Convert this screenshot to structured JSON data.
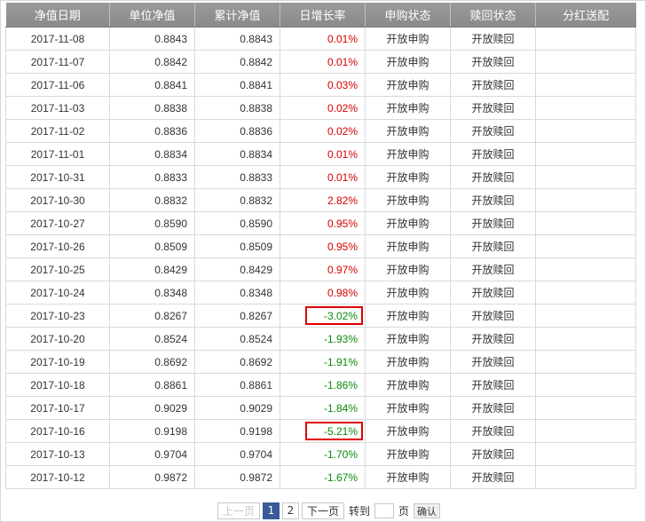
{
  "table": {
    "headers": [
      "净值日期",
      "单位净值",
      "累计净值",
      "日增长率",
      "申购状态",
      "赎回状态",
      "分红送配"
    ],
    "rows": [
      {
        "date": "2017-11-08",
        "nav": "0.8843",
        "acc": "0.8843",
        "chg": "0.01%",
        "dir": "up",
        "buy": "开放申购",
        "sell": "开放赎回",
        "div": "",
        "highlight": false
      },
      {
        "date": "2017-11-07",
        "nav": "0.8842",
        "acc": "0.8842",
        "chg": "0.01%",
        "dir": "up",
        "buy": "开放申购",
        "sell": "开放赎回",
        "div": "",
        "highlight": false
      },
      {
        "date": "2017-11-06",
        "nav": "0.8841",
        "acc": "0.8841",
        "chg": "0.03%",
        "dir": "up",
        "buy": "开放申购",
        "sell": "开放赎回",
        "div": "",
        "highlight": false
      },
      {
        "date": "2017-11-03",
        "nav": "0.8838",
        "acc": "0.8838",
        "chg": "0.02%",
        "dir": "up",
        "buy": "开放申购",
        "sell": "开放赎回",
        "div": "",
        "highlight": false
      },
      {
        "date": "2017-11-02",
        "nav": "0.8836",
        "acc": "0.8836",
        "chg": "0.02%",
        "dir": "up",
        "buy": "开放申购",
        "sell": "开放赎回",
        "div": "",
        "highlight": false
      },
      {
        "date": "2017-11-01",
        "nav": "0.8834",
        "acc": "0.8834",
        "chg": "0.01%",
        "dir": "up",
        "buy": "开放申购",
        "sell": "开放赎回",
        "div": "",
        "highlight": false
      },
      {
        "date": "2017-10-31",
        "nav": "0.8833",
        "acc": "0.8833",
        "chg": "0.01%",
        "dir": "up",
        "buy": "开放申购",
        "sell": "开放赎回",
        "div": "",
        "highlight": false
      },
      {
        "date": "2017-10-30",
        "nav": "0.8832",
        "acc": "0.8832",
        "chg": "2.82%",
        "dir": "up",
        "buy": "开放申购",
        "sell": "开放赎回",
        "div": "",
        "highlight": false
      },
      {
        "date": "2017-10-27",
        "nav": "0.8590",
        "acc": "0.8590",
        "chg": "0.95%",
        "dir": "up",
        "buy": "开放申购",
        "sell": "开放赎回",
        "div": "",
        "highlight": false
      },
      {
        "date": "2017-10-26",
        "nav": "0.8509",
        "acc": "0.8509",
        "chg": "0.95%",
        "dir": "up",
        "buy": "开放申购",
        "sell": "开放赎回",
        "div": "",
        "highlight": false
      },
      {
        "date": "2017-10-25",
        "nav": "0.8429",
        "acc": "0.8429",
        "chg": "0.97%",
        "dir": "up",
        "buy": "开放申购",
        "sell": "开放赎回",
        "div": "",
        "highlight": false
      },
      {
        "date": "2017-10-24",
        "nav": "0.8348",
        "acc": "0.8348",
        "chg": "0.98%",
        "dir": "up",
        "buy": "开放申购",
        "sell": "开放赎回",
        "div": "",
        "highlight": false
      },
      {
        "date": "2017-10-23",
        "nav": "0.8267",
        "acc": "0.8267",
        "chg": "-3.02%",
        "dir": "down",
        "buy": "开放申购",
        "sell": "开放赎回",
        "div": "",
        "highlight": true
      },
      {
        "date": "2017-10-20",
        "nav": "0.8524",
        "acc": "0.8524",
        "chg": "-1.93%",
        "dir": "down",
        "buy": "开放申购",
        "sell": "开放赎回",
        "div": "",
        "highlight": false
      },
      {
        "date": "2017-10-19",
        "nav": "0.8692",
        "acc": "0.8692",
        "chg": "-1.91%",
        "dir": "down",
        "buy": "开放申购",
        "sell": "开放赎回",
        "div": "",
        "highlight": false
      },
      {
        "date": "2017-10-18",
        "nav": "0.8861",
        "acc": "0.8861",
        "chg": "-1.86%",
        "dir": "down",
        "buy": "开放申购",
        "sell": "开放赎回",
        "div": "",
        "highlight": false
      },
      {
        "date": "2017-10-17",
        "nav": "0.9029",
        "acc": "0.9029",
        "chg": "-1.84%",
        "dir": "down",
        "buy": "开放申购",
        "sell": "开放赎回",
        "div": "",
        "highlight": false
      },
      {
        "date": "2017-10-16",
        "nav": "0.9198",
        "acc": "0.9198",
        "chg": "-5.21%",
        "dir": "down",
        "buy": "开放申购",
        "sell": "开放赎回",
        "div": "",
        "highlight": true
      },
      {
        "date": "2017-10-13",
        "nav": "0.9704",
        "acc": "0.9704",
        "chg": "-1.70%",
        "dir": "down",
        "buy": "开放申购",
        "sell": "开放赎回",
        "div": "",
        "highlight": false
      },
      {
        "date": "2017-10-12",
        "nav": "0.9872",
        "acc": "0.9872",
        "chg": "-1.67%",
        "dir": "down",
        "buy": "开放申购",
        "sell": "开放赎回",
        "div": "",
        "highlight": false
      }
    ]
  },
  "colors": {
    "up": "#d60000",
    "down": "#0a8a0a",
    "highlight_border": "#e00000",
    "header_bg": "#8f8f8f"
  },
  "pager": {
    "prev_label": "上一页",
    "pages": [
      "1",
      "2"
    ],
    "current_page": "1",
    "next_label": "下一页",
    "goto_label": "转到",
    "goto_value": "",
    "page_suffix": "页",
    "confirm_label": "确认"
  }
}
